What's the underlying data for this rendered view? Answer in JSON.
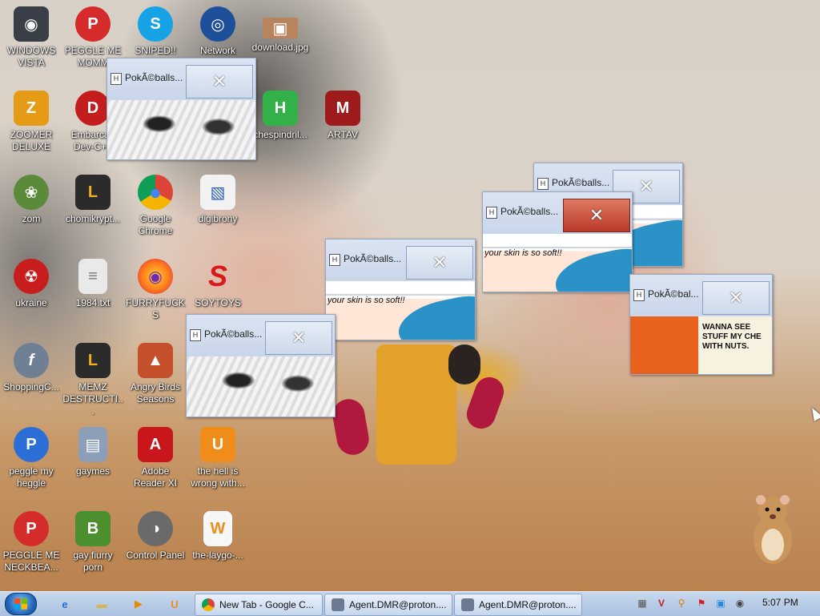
{
  "desktop": {
    "icons": [
      {
        "label": "WINDOWS VISTA",
        "glyph": "◉",
        "color": "#3a3f47",
        "icon": "vista-orb-icon"
      },
      {
        "label": "PEGGLE ME MOMM",
        "glyph": "P",
        "color": "#d62b2b",
        "icon": "peggle-icon"
      },
      {
        "label": "SNIPED!! EPIC",
        "glyph": "S",
        "color": "#16a3e5",
        "icon": "skype-icon"
      },
      {
        "label": "Network",
        "glyph": "◎",
        "color": "#1d4f9a",
        "icon": "network-globe-icon"
      },
      {
        "label": "download.jpg",
        "glyph": "▣",
        "color": "#b8845e",
        "icon": "image-file-icon"
      },
      {
        "label": "ZOOMER DELUXE",
        "glyph": "Z",
        "color": "#e69b16",
        "icon": "zuma-icon"
      },
      {
        "label": "Embarcad Dev-C++",
        "glyph": "D",
        "color": "#c41d1d",
        "icon": "devcpp-icon"
      },
      {
        "label": "chespindril...",
        "glyph": "H",
        "color": "#34b24a",
        "icon": "h-app-icon"
      },
      {
        "label": "ARTAV",
        "glyph": "M",
        "color": "#9d1b1b",
        "icon": "artav-icon"
      },
      {
        "label": "zom",
        "glyph": "❀",
        "color": "#5a8a3a",
        "icon": "plant-icon"
      },
      {
        "label": "chomikrypt...",
        "glyph": "L",
        "color": "#2b2b2b",
        "icon": "shortcut-file-icon"
      },
      {
        "label": "Google Chrome",
        "glyph": "●",
        "color": "#db4437",
        "icon": "chrome-icon"
      },
      {
        "label": "digibrony",
        "glyph": "▧",
        "color": "#f2f2f2",
        "icon": "document-icon"
      },
      {
        "label": "ukraine",
        "glyph": "☢",
        "color": "#c81d1d",
        "icon": "radiation-icon"
      },
      {
        "label": "1984.txt",
        "glyph": "≡",
        "color": "#e9e9e9",
        "icon": "text-file-icon"
      },
      {
        "label": "FURRYFUCKS",
        "glyph": "◉",
        "color": "#ff7a1a",
        "icon": "firefox-icon"
      },
      {
        "label": "SOYTOYS",
        "glyph": "S",
        "color": "#d91a1a",
        "icon": "soytoys-icon"
      },
      {
        "label": "ShoppingC...",
        "glyph": "f",
        "color": "#6f7f94",
        "icon": "flash-icon"
      },
      {
        "label": "MEMZ DESTRUCTI...",
        "glyph": "L",
        "color": "#2b2b2b",
        "icon": "shortcut-file-icon"
      },
      {
        "label": "Angry Birds Seasons",
        "glyph": "▲",
        "color": "#c4512b",
        "icon": "angry-birds-icon"
      },
      {
        "label": "peggle my heggle",
        "glyph": "P",
        "color": "#2b6fd6",
        "icon": "peggle-icon"
      },
      {
        "label": "gaymes",
        "glyph": "▤",
        "color": "#8d9fb8",
        "icon": "games-folder-icon"
      },
      {
        "label": "Adobe Reader XI",
        "glyph": "A",
        "color": "#c8161b",
        "icon": "adobe-reader-icon"
      },
      {
        "label": "the hell is wrong with...",
        "glyph": "U",
        "color": "#f08c1a",
        "icon": "uc-browser-icon"
      },
      {
        "label": "PEGGLE ME NECKBEA...",
        "glyph": "P",
        "color": "#d62b2b",
        "icon": "peggle-icon"
      },
      {
        "label": "gay fiurry porn",
        "glyph": "B",
        "color": "#4b8f2e",
        "icon": "box-app-icon"
      },
      {
        "label": "Control Panel",
        "glyph": "◑",
        "color": "#6a6a6a",
        "icon": "control-panel-icon"
      },
      {
        "label": "the-laygo-...",
        "glyph": "W",
        "color": "#f7f7f7",
        "icon": "webp-file-icon"
      }
    ]
  },
  "popups": [
    {
      "title": "PokÃ©balls...",
      "kind": "manga",
      "active": false
    },
    {
      "title": "PokÃ©balls...",
      "kind": "manga",
      "active": false
    },
    {
      "title": "PokÃ©balls...",
      "kind": "shark",
      "active": false,
      "caption": "your skin is so soft!!"
    },
    {
      "title": "PokÃ©balls...",
      "kind": "shark",
      "active": false,
      "caption": ""
    },
    {
      "title": "PokÃ©balls...",
      "kind": "shark",
      "active": true,
      "caption": "your skin is so soft!!"
    },
    {
      "title": "PokÃ©bal...",
      "kind": "comic",
      "active": false,
      "caption": "WANNA SEE STUFF MY CHE WITH NUTS."
    }
  ],
  "close_glyph": "✕",
  "taskbar": {
    "quick_launch": [
      {
        "glyph": "e",
        "color": "#1e6fd6",
        "icon": "internet-explorer-icon"
      },
      {
        "glyph": "▬",
        "color": "#d9b44a",
        "icon": "folder-icon"
      },
      {
        "glyph": "▶",
        "color": "#e68a00",
        "icon": "media-player-icon"
      },
      {
        "glyph": "U",
        "color": "#f08c1a",
        "icon": "uc-browser-icon"
      }
    ],
    "buttons": [
      {
        "label": "New Tab - Google C...",
        "color": "#db4437",
        "icon": "chrome-icon"
      },
      {
        "label": "Agent.DMR@proton....",
        "color": "#6b7a90",
        "icon": "window-app-icon"
      },
      {
        "label": "Agent.DMR@proton....",
        "color": "#6b7a90",
        "icon": "window-app-icon"
      }
    ],
    "tray": [
      {
        "glyph": "▦",
        "color": "#555",
        "icon": "network-tray-icon"
      },
      {
        "glyph": "V",
        "color": "#c41d1d",
        "icon": "antivirus-tray-icon"
      },
      {
        "glyph": "⚲",
        "color": "#e07a00",
        "icon": "search-tray-icon"
      },
      {
        "glyph": "⚑",
        "color": "#d32020",
        "icon": "action-center-flag-icon"
      },
      {
        "glyph": "▣",
        "color": "#1d8be0",
        "icon": "display-tray-icon"
      },
      {
        "glyph": "◉",
        "color": "#444",
        "icon": "volume-tray-icon"
      }
    ],
    "clock": "5:07 PM"
  }
}
